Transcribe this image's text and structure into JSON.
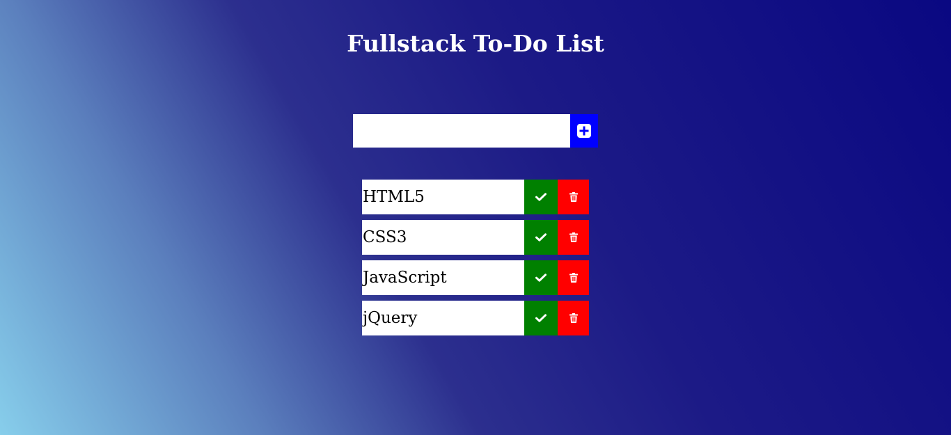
{
  "header": {
    "title": "Fullstack To-Do List"
  },
  "add_form": {
    "input_value": "",
    "input_placeholder": "",
    "add_icon": "plus-square-icon"
  },
  "todos": [
    {
      "text": "HTML5"
    },
    {
      "text": "CSS3"
    },
    {
      "text": "JavaScript"
    },
    {
      "text": "jQuery"
    }
  ],
  "icons": {
    "complete": "check-icon",
    "delete": "trash-icon"
  },
  "colors": {
    "add_button": "#0000ff",
    "complete_button": "#008000",
    "delete_button": "#ff0000",
    "item_background": "#ffffff",
    "title_text": "#ffffff"
  }
}
